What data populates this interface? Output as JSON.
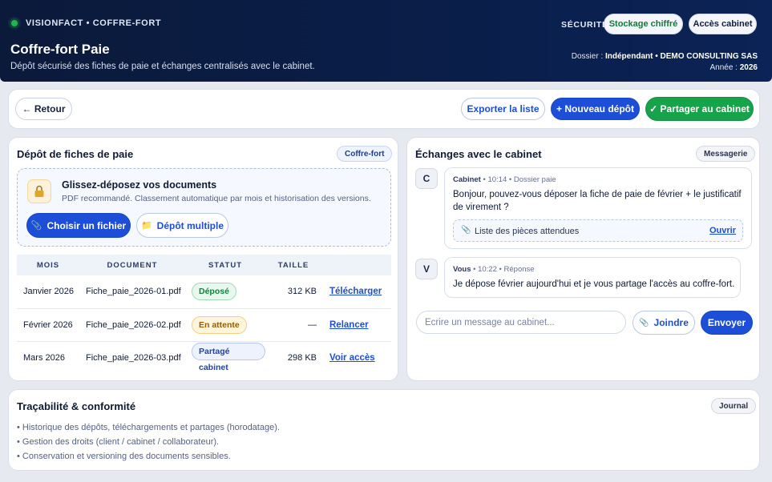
{
  "header": {
    "brand": "VISIONFACT • COFFRE-FORT",
    "title": "Coffre-fort Paie",
    "subtitle": "Dépôt sécurisé des fiches de paie et échanges centralisés avec le cabinet.",
    "security_label": "SÉCURITÉ",
    "badge_storage": "Stockage chiffré",
    "badge_access": "Accès cabinet",
    "dossier_label": "Dossier :",
    "dossier_value": "Indépendant • DEMO CONSULTING SAS",
    "year_label": "Année :",
    "year_value": "2026"
  },
  "toolbar": {
    "back": "← Retour",
    "export": "Exporter la liste",
    "new_deposit": "+ Nouveau dépôt",
    "share": "✓ Partager au cabinet"
  },
  "deposit": {
    "title": "Dépôt de fiches de paie",
    "tag": "Coffre-fort",
    "drop_title": "Glissez-déposez vos documents",
    "drop_sub": "PDF recommandé. Classement automatique par mois et historisation des versions.",
    "choose_file": "Choisir un fichier",
    "multi_upload": "Dépôt multiple",
    "columns": [
      "MOIS",
      "DOCUMENT",
      "STATUT",
      "TAILLE",
      ""
    ],
    "rows": [
      {
        "month": "Janvier 2026",
        "doc": "Fiche_paie_2026-01.pdf",
        "status": "Déposé",
        "size": "312 KB",
        "action": "Télécharger"
      },
      {
        "month": "Février 2026",
        "doc": "Fiche_paie_2026-02.pdf",
        "status": "En attente",
        "size": "—",
        "action": "Relancer"
      },
      {
        "month": "Mars 2026",
        "doc": "Fiche_paie_2026-03.pdf",
        "status": "Partagé cabinet",
        "size": "298 KB",
        "action": "Voir accès"
      }
    ]
  },
  "chat": {
    "title": "Échanges avec le cabinet",
    "tag": "Messagerie",
    "messages": [
      {
        "avatar": "C",
        "author": "Cabinet",
        "meta": "• 10:14 • Dossier paie",
        "text": "Bonjour, pouvez-vous déposer la fiche de paie de février + le justificatif de virement ?",
        "attachment": "Liste des pièces attendues",
        "attachment_action": "Ouvrir"
      },
      {
        "avatar": "V",
        "author": "Vous",
        "meta": "• 10:22 • Réponse",
        "text": "Je dépose février aujourd'hui et je vous partage l'accès au coffre-fort."
      }
    ],
    "input_placeholder": "Ecrire un message au cabinet...",
    "attach_button": "Joindre",
    "send_button": "Envoyer"
  },
  "compliance": {
    "title": "Traçabilité & conformité",
    "tag": "Journal",
    "items": [
      "• Historique des dépôts, téléchargements et partages (horodatage).",
      "• Gestion des droits (client / cabinet / collaborateur).",
      "• Conservation et versioning des documents sensibles."
    ]
  },
  "colors": {
    "header_bg": "#0b1a3a",
    "primary": "#1d4ed8",
    "success": "#17a34a"
  }
}
